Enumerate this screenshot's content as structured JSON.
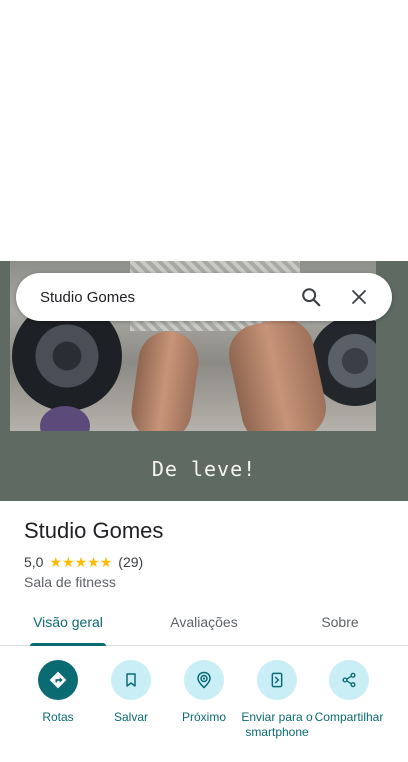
{
  "search": {
    "query": "Studio Gomes"
  },
  "photo": {
    "caption": "De leve!"
  },
  "place": {
    "name": "Studio Gomes",
    "rating": "5,0",
    "reviews": "(29)",
    "category": "Sala de fitness",
    "star_count": 5
  },
  "tabs": [
    {
      "label": "Visão geral"
    },
    {
      "label": "Avaliações"
    },
    {
      "label": "Sobre"
    }
  ],
  "actions": [
    {
      "label": "Rotas",
      "icon": "directions-icon"
    },
    {
      "label": "Salvar",
      "icon": "bookmark-icon"
    },
    {
      "label": "Próximo",
      "icon": "nearby-icon"
    },
    {
      "label": "Enviar para o smartphone",
      "icon": "send-to-phone-icon"
    },
    {
      "label": "Compartilhar",
      "icon": "share-icon"
    }
  ],
  "colors": {
    "accent": "#0b6b73",
    "chip_bg": "#c9eef6",
    "star": "#fbbc04"
  }
}
